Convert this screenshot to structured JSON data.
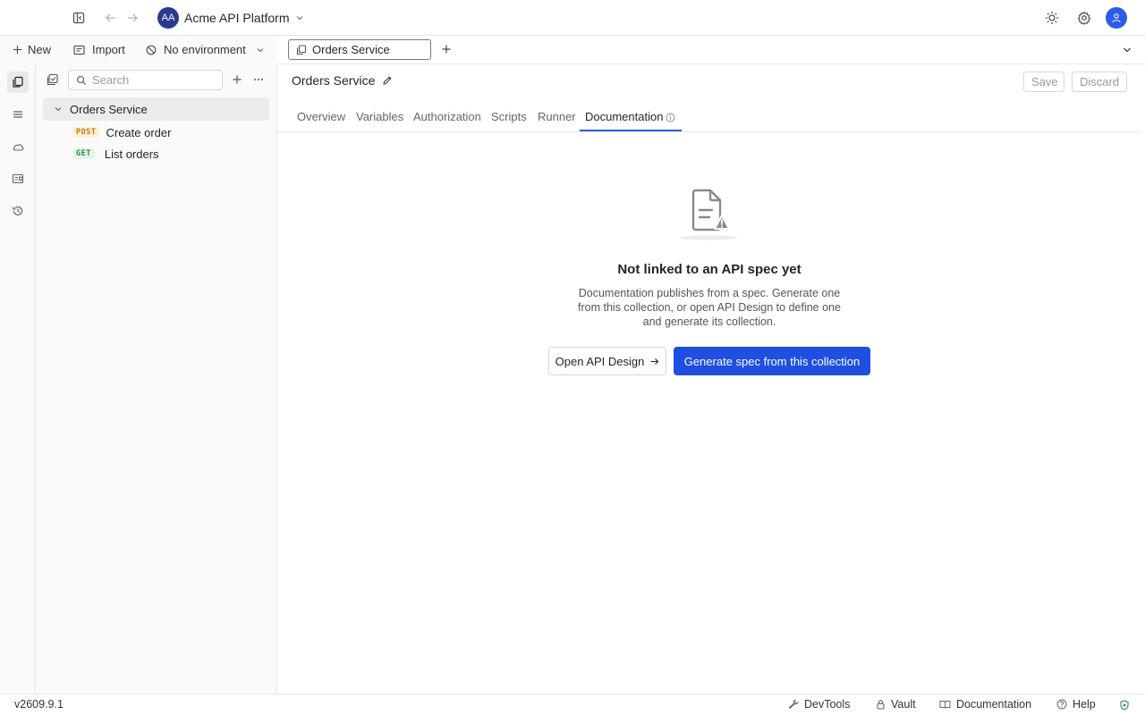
{
  "topbar": {
    "workspace_initials": "AA",
    "workspace_name": "Acme API Platform",
    "icons": [
      "sidebar-toggle-icon",
      "back-arrow-icon",
      "forward-arrow-icon",
      "chevron-down-icon",
      "sun-icon",
      "gear-icon",
      "user-icon"
    ]
  },
  "actions": {
    "new_label": "New",
    "import_label": "Import",
    "environment_label": "No environment"
  },
  "sidebar": {
    "search_placeholder": "Search",
    "collection_name": "Orders Service",
    "requests": [
      {
        "method": "POST",
        "name": "Create order"
      },
      {
        "method": "GET",
        "name": "List orders"
      }
    ]
  },
  "rail": {
    "items": [
      "collections-icon",
      "list-icon",
      "cloud-icon",
      "console-icon",
      "history-icon"
    ]
  },
  "tabstrip": {
    "open_tab": "Orders Service"
  },
  "header": {
    "title": "Orders Service",
    "save_label": "Save",
    "discard_label": "Discard"
  },
  "tabs": [
    {
      "label": "Overview"
    },
    {
      "label": "Variables"
    },
    {
      "label": "Authorization"
    },
    {
      "label": "Scripts"
    },
    {
      "label": "Runner"
    },
    {
      "label": "Documentation",
      "active": true
    }
  ],
  "empty_state": {
    "title": "Not linked to an API spec yet",
    "description": "Documentation publishes from a spec. Generate one from this collection, or open API Design to define one and generate its collection.",
    "secondary_button": "Open API Design",
    "primary_button": "Generate spec from this collection"
  },
  "statusbar": {
    "version": "v2609.9.1",
    "devtools": "DevTools",
    "vault": "Vault",
    "documentation": "Documentation",
    "help": "Help"
  },
  "colors": {
    "accent": "#1f4fe0",
    "tab_underline": "#2b5ce6",
    "workspace_avatar": "#2a3a8f",
    "post_method": "#c77700",
    "get_method": "#2f8b4a"
  }
}
